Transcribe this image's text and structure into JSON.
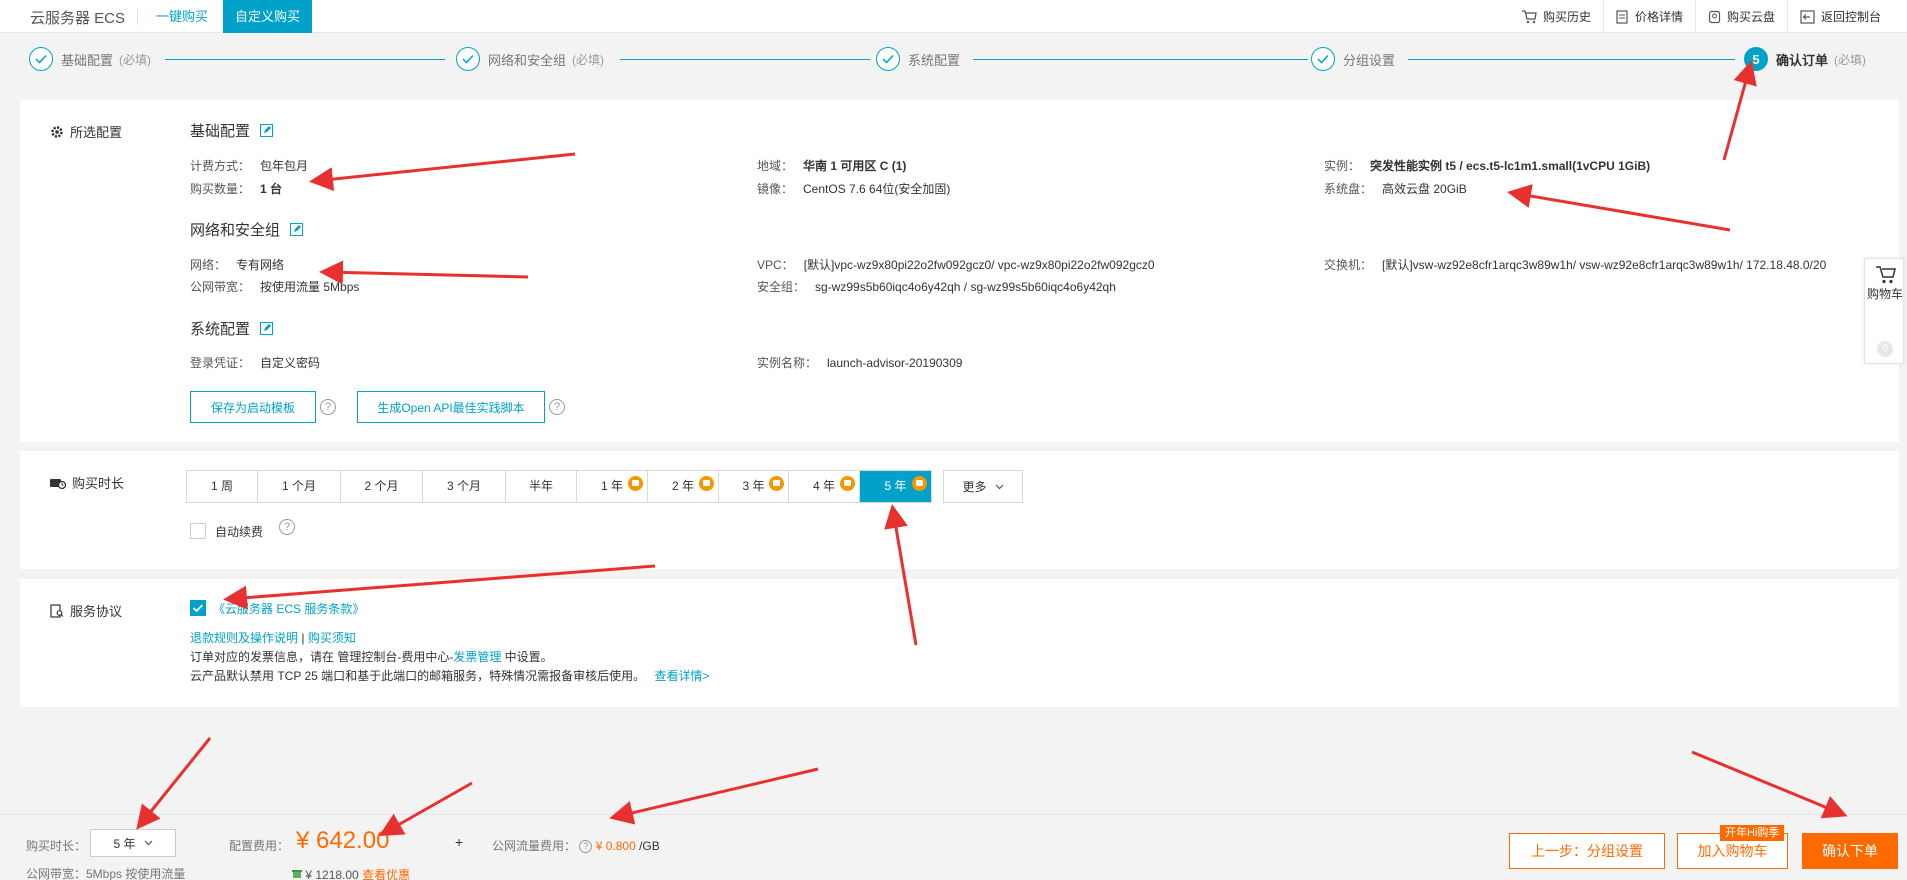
{
  "topbar": {
    "brand": "云服务器 ECS",
    "tabs": [
      "一键购买",
      "自定义购买"
    ],
    "links": [
      "购买历史",
      "价格详情",
      "购买云盘",
      "返回控制台"
    ]
  },
  "steps": [
    {
      "label": "基础配置",
      "req": "(必填)"
    },
    {
      "label": "网络和安全组",
      "req": "(必填)"
    },
    {
      "label": "系统配置",
      "req": ""
    },
    {
      "label": "分组设置",
      "req": ""
    },
    {
      "label": "确认订单",
      "req": "(必填)",
      "num": "5"
    }
  ],
  "selected": {
    "panel_label": "所选配置",
    "basic": {
      "title": "基础配置",
      "billing_k": "计费方式：",
      "billing_v": "包年包月",
      "qty_k": "购买数量：",
      "qty_v": "1 台",
      "region_k": "地域：",
      "region_v": "华南 1 可用区 C (1)",
      "image_k": "镜像：",
      "image_v": "CentOS 7.6 64位(安全加固)",
      "instance_k": "实例：",
      "instance_v": "突发性能实例 t5 / ecs.t5-lc1m1.small(1vCPU 1GiB)",
      "disk_k": "系统盘：",
      "disk_v": "高效云盘 20GiB"
    },
    "network": {
      "title": "网络和安全组",
      "net_k": "网络：",
      "net_v": "专有网络",
      "bw_k": "公网带宽：",
      "bw_v": "按使用流量 5Mbps",
      "vpc_k": "VPC：",
      "vpc_v": "[默认]vpc-wz9x80pi22o2fw092gcz0/ vpc-wz9x80pi22o2fw092gcz0",
      "sg_k": "安全组：",
      "sg_v": "sg-wz99s5b60iqc4o6y42qh / sg-wz99s5b60iqc4o6y42qh",
      "sw_k": "交换机：",
      "sw_v": "[默认]vsw-wz92e8cfr1arqc3w89w1h/ vsw-wz92e8cfr1arqc3w89w1h/ 172.18.48.0/20"
    },
    "system": {
      "title": "系统配置",
      "login_k": "登录凭证：",
      "login_v": "自定义密码",
      "name_k": "实例名称：",
      "name_v": "launch-advisor-20190309"
    },
    "save_template": "保存为启动模板",
    "gen_api": "生成Open API最佳实践脚本"
  },
  "duration": {
    "panel_label": "购买时长",
    "options": [
      "1 周",
      "1 个月",
      "2 个月",
      "3 个月",
      "半年",
      "1 年",
      "2 年",
      "3 年",
      "4 年",
      "5 年"
    ],
    "selected": "5 年",
    "more": "更多",
    "auto_renew": "自动续费"
  },
  "agreement": {
    "panel_label": "服务协议",
    "terms": "《云服务器 ECS 服务条款》",
    "refund": "退款规则及操作说明",
    "sep": "|",
    "notice": "购买须知",
    "invoice_pre": "订单对应的发票信息，请在 管理控制台-费用中心-",
    "invoice_link": "发票管理",
    "invoice_post": " 中设置。",
    "tcp": "云产品默认禁用 TCP 25 端口和基于此端口的邮箱服务，特殊情况需报备审核后使用。",
    "detail": "查看详情>"
  },
  "bottom": {
    "duration_label": "购买时长：",
    "duration_value": "5 年",
    "bandwidth_note": "公网带宽：5Mbps 按使用流量",
    "config_label": "配置费用：",
    "price": "¥ 642.00",
    "orig": "¥ 1218.00",
    "discount": "查看优惠",
    "plus": "+",
    "traffic_label": "公网流量费用：",
    "traffic_value": "¥ 0.800",
    "traffic_unit": "/GB",
    "prev": "上一步：分组设置",
    "add_cart": "加入购物车",
    "hi": "开年Hi购季",
    "confirm": "确认下单"
  },
  "cart": {
    "label": "购物车",
    "count": "0"
  },
  "colors": {
    "accent": "#00a2ca",
    "orange": "#ff6a00",
    "arrow": "#e8312f"
  }
}
